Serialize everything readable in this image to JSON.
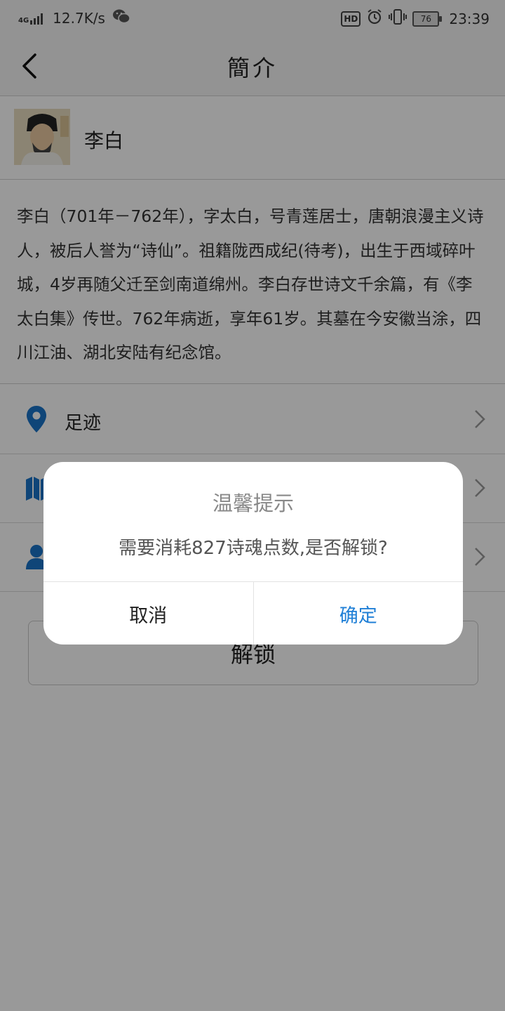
{
  "status_bar": {
    "network": "4G",
    "speed": "12.7K/s",
    "hd": "HD",
    "battery": "76",
    "time": "23:39"
  },
  "nav": {
    "title": "簡介"
  },
  "poet": {
    "name": "李白",
    "bio": "李白（701年－762年），字太白，号青莲居士，唐朝浪漫主义诗人，被后人誉为“诗仙”。祖籍陇西成纪(待考)，出生于西域碎叶城，4岁再随父迁至剑南道绵州。李白存世诗文千余篇，有《李太白集》传世。762年病逝，享年61岁。其墓在今安徽当涂，四川江油、湖北安陆有纪念馆。"
  },
  "menu": {
    "items": [
      {
        "label": "足迹",
        "icon": "location-pin-icon"
      },
      {
        "label": "",
        "icon": "map-icon"
      },
      {
        "label": "",
        "icon": "person-icon"
      }
    ]
  },
  "unlock_button": "解锁",
  "dialog": {
    "title": "温馨提示",
    "message": "需要消耗827诗魂点数,是否解锁?",
    "cancel": "取消",
    "confirm": "确定"
  },
  "colors": {
    "accent": "#1f7fd6",
    "icon_blue": "#1a73c9"
  }
}
